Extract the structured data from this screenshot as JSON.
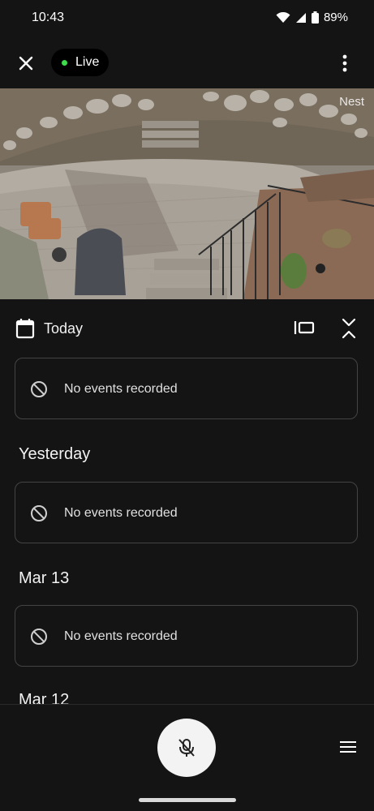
{
  "status_bar": {
    "time": "10:43",
    "battery": "89%"
  },
  "top_bar": {
    "live_label": "Live"
  },
  "camera": {
    "watermark": "Nest"
  },
  "timeline": {
    "date_label": "Today",
    "days": [
      {
        "heading": "",
        "message": "No events recorded"
      },
      {
        "heading": "Yesterday",
        "message": "No events recorded"
      },
      {
        "heading": "Mar 13",
        "message": "No events recorded"
      }
    ],
    "partial_heading": "Mar 12"
  },
  "colors": {
    "live_dot": "#3ddc4b",
    "background": "#141414",
    "card_border": "#444444"
  },
  "icons": {
    "close": "close-icon",
    "more": "more-vert-icon",
    "calendar": "calendar-icon",
    "filmstrip": "filmstrip-icon",
    "collapse": "collapse-icon",
    "no_events": "ban-icon",
    "mic_off": "mic-off-icon",
    "menu": "menu-icon"
  }
}
